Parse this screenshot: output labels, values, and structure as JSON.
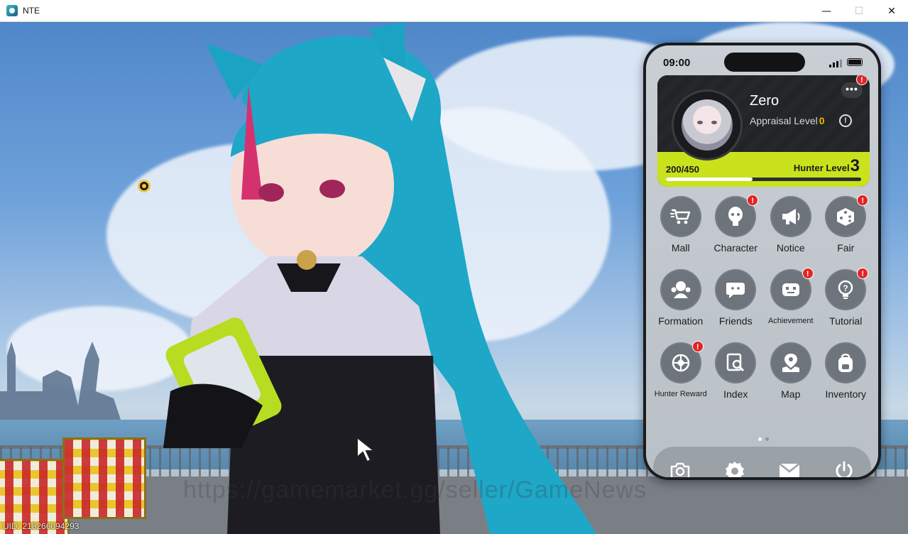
{
  "window": {
    "title": "NTE",
    "minimize": "—",
    "maximize": "☐",
    "close": "✕"
  },
  "overlay": {
    "watermark": "https://gamemarket.gg/seller/GameNews",
    "uid": "UID: 218266094293"
  },
  "phone": {
    "status": {
      "time": "09:00"
    },
    "profile": {
      "name": "Zero",
      "appraisal_label": "Appraisal Level",
      "appraisal_level": "0",
      "exp": "200/450",
      "exp_fraction": 0.444,
      "hunter_label": "Hunter Level",
      "hunter_level": "3",
      "more_badge": "!"
    },
    "apps": [
      {
        "label": "Mall",
        "icon": "cart-icon",
        "badge": ""
      },
      {
        "label": "Character",
        "icon": "character-icon",
        "badge": "!"
      },
      {
        "label": "Notice",
        "icon": "megaphone-icon",
        "badge": ""
      },
      {
        "label": "Fair",
        "icon": "dice-icon",
        "badge": "!"
      },
      {
        "label": "Formation",
        "icon": "formation-icon",
        "badge": ""
      },
      {
        "label": "Friends",
        "icon": "chat-icon",
        "badge": ""
      },
      {
        "label": "Achievement",
        "icon": "robot-icon",
        "badge": "!"
      },
      {
        "label": "Tutorial",
        "icon": "lightbulb-icon",
        "badge": "!"
      },
      {
        "label": "Hunter Reward",
        "icon": "target-icon",
        "badge": "!"
      },
      {
        "label": "Index",
        "icon": "search-book-icon",
        "badge": ""
      },
      {
        "label": "Map",
        "icon": "map-pin-icon",
        "badge": ""
      },
      {
        "label": "Inventory",
        "icon": "backpack-icon",
        "badge": ""
      }
    ],
    "page_dots": {
      "total": 2,
      "active": 0
    },
    "dock": [
      "camera-icon",
      "gear-icon",
      "mail-icon",
      "power-icon"
    ]
  },
  "colors": {
    "accent": "#c9e21b",
    "badge": "#e02525",
    "appraisal": "#f0b400"
  }
}
